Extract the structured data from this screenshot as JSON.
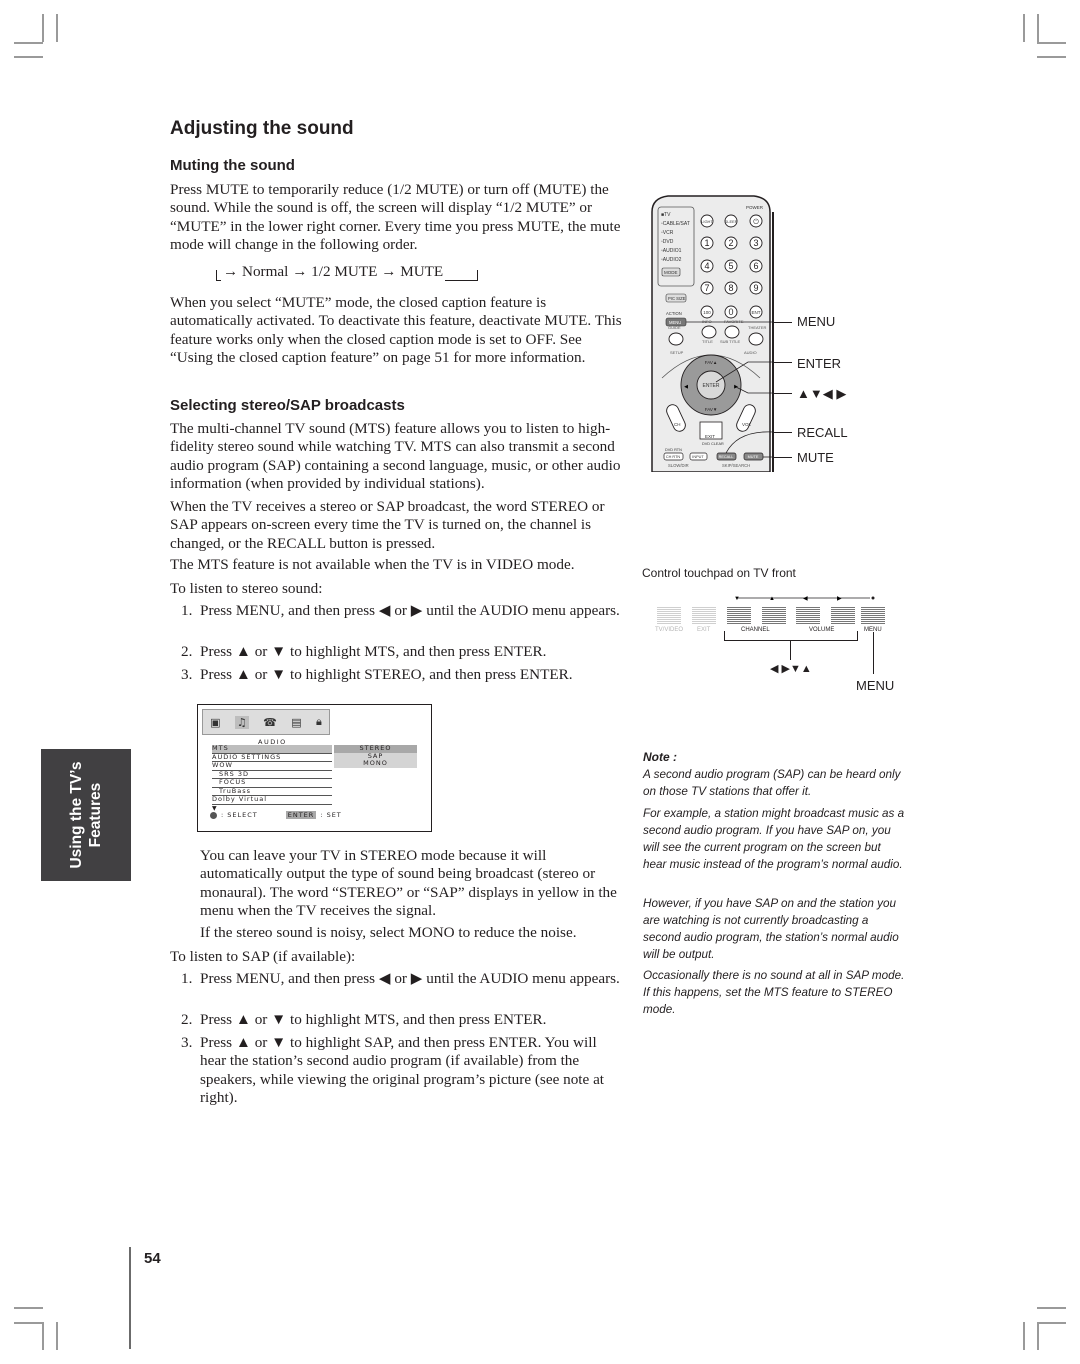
{
  "page": {
    "title": "Adjusting the sound",
    "page_number": "54",
    "side_tab": {
      "line1": "Using the TV’s",
      "line2": "Features"
    }
  },
  "muting": {
    "heading": "Muting the sound",
    "intro": "Press MUTE to temporarily reduce (1/2 MUTE) or turn off (MUTE) the sound. While the sound is off, the screen will display “1/2 MUTE” or “MUTE” in the lower right corner. Every time you press MUTE, the mute mode will change in the following order.",
    "cycle": [
      "Normal",
      "1/2 MUTE",
      "MUTE"
    ],
    "cc_note": "When you select “MUTE” mode, the closed caption feature is automatically activated. To deactivate this feature, deactivate MUTE. This feature works only when the closed caption mode is set to OFF. See “Using the closed caption feature” on page 51 for more information."
  },
  "stereo": {
    "heading": "Selecting stereo/SAP broadcasts",
    "p1": "The multi-channel TV sound (MTS) feature allows you to listen to high-fidelity stereo sound while watching TV. MTS can also transmit a second audio program (SAP) containing a second language, music, or other audio information (when provided by individual stations).",
    "p2": "When the TV receives a stereo or SAP broadcast, the word STEREO or SAP appears on-screen every time the TV is turned on, the channel is changed, or the RECALL button is pressed.",
    "p3": "The MTS feature is not available when the TV is in VIDEO mode.",
    "stereo_intro": "To listen to stereo sound:",
    "stereo_steps": [
      {
        "num": "1.",
        "text": "Press MENU, and then press ◀ or ▶ until the AUDIO menu appears."
      },
      {
        "num": "2.",
        "text": "Press ▲ or ▼ to highlight MTS, and then press ENTER."
      },
      {
        "num": "3.",
        "text": "Press ▲ or ▼ to highlight STEREO, and then press ENTER."
      }
    ],
    "after1": "You can leave your TV in STEREO mode because it will automatically output the type of sound being broadcast (stereo or monaural). The word “STEREO” or “SAP” displays in yellow in the menu when the TV receives the signal.",
    "after2": "If the stereo sound is noisy, select MONO to reduce the noise.",
    "sap_intro": "To listen to SAP (if available):",
    "sap_steps": [
      {
        "num": "1.",
        "text": "Press MENU, and then press ◀ or ▶ until the AUDIO menu appears."
      },
      {
        "num": "2.",
        "text": "Press ▲ or ▼ to highlight MTS, and then press ENTER."
      },
      {
        "num": "3.",
        "text": "Press ▲ or ▼ to highlight SAP, and then press ENTER. You will hear the station’s second audio program (if available) from the speakers, while viewing the original program’s picture (see note at right)."
      }
    ]
  },
  "osd_menu": {
    "title": "AUDIO",
    "icons": [
      "picture-icon",
      "audio-icon",
      "setup-icon",
      "applications-icon",
      "lock-icon"
    ],
    "rows": [
      {
        "label": "MTS",
        "selected": true
      },
      {
        "label": "AUDIO SETTINGS"
      },
      {
        "label": "WOW"
      },
      {
        "label": "SRS 3D",
        "indent": true
      },
      {
        "label": "FOCUS",
        "indent": true
      },
      {
        "label": "TruBass",
        "indent": true
      },
      {
        "label": "Dolby Virtual"
      }
    ],
    "options": [
      {
        "label": "STEREO",
        "selected": true
      },
      {
        "label": "SAP"
      },
      {
        "label": "MONO"
      }
    ],
    "more": "▼",
    "footer_select": ": SELECT",
    "footer_enter": "ENTER",
    "footer_set": ": SET"
  },
  "remote": {
    "mode_list": [
      "TV",
      "CABLE/SAT",
      "VCR",
      "DVD",
      "AUDIO1",
      "AUDIO2"
    ],
    "mode_button": "MODE",
    "top_buttons": [
      "LIGHT",
      "SLEEP",
      "POWER"
    ],
    "digits": [
      "1",
      "2",
      "3",
      "4",
      "5",
      "6",
      "7",
      "8",
      "9",
      "100",
      "0",
      "ENT"
    ],
    "resize": "PIC SIZE",
    "action": "ACTION",
    "menu": "MENU",
    "arc_labels": [
      "GUIDE",
      "INFO",
      "FAVORITE",
      "THEATER LIST",
      "SETUP",
      "TITLE",
      "SUB TITLE",
      "AUDIO"
    ],
    "nav": {
      "up": "FAV▲",
      "down": "FAV▼",
      "center": "ENTER"
    },
    "ch": "CH",
    "vol": "VOL",
    "exit": "EXIT",
    "dvd_clear": "DVD CLEAR",
    "dvd_rtn": "DVD RTN",
    "row_buttons": [
      "CH RTN",
      "INPUT",
      "RECALL",
      "MUTE"
    ],
    "bottom_labels": [
      "SLOW/DIR",
      "SKIP/SEARCH"
    ],
    "callouts": [
      "MENU",
      "ENTER",
      "▲▼◀ ▶",
      "RECALL",
      "MUTE"
    ]
  },
  "touchpad": {
    "caption": "Control touchpad on TV front",
    "buttons": [
      {
        "label": "TV/VIDEO",
        "faint": true
      },
      {
        "label": "EXIT",
        "faint": true
      },
      {
        "label": ""
      },
      {
        "label": "CHANNEL"
      },
      {
        "label": ""
      },
      {
        "label": "VOLUME"
      },
      {
        "label": "MENU"
      }
    ],
    "arrow_markers": [
      "▼",
      "▲",
      "◀",
      "▶",
      "•"
    ],
    "arrows_callout": "◀ ▶▼▲",
    "menu_callout": "MENU"
  },
  "note": {
    "heading": "Note :",
    "paragraphs": [
      "A second audio program (SAP) can be heard only on those TV stations that offer it.",
      "For example, a station might broadcast music as a second audio program. If you have SAP on, you will see the current program on the screen but hear music instead of the program’s normal audio.",
      "However, if you have SAP on and the station you are watching is not currently broadcasting a second audio program, the station’s normal audio will be output.",
      "Occasionally there is no sound at all in SAP mode. If this happens, set the MTS feature to STEREO mode."
    ]
  }
}
